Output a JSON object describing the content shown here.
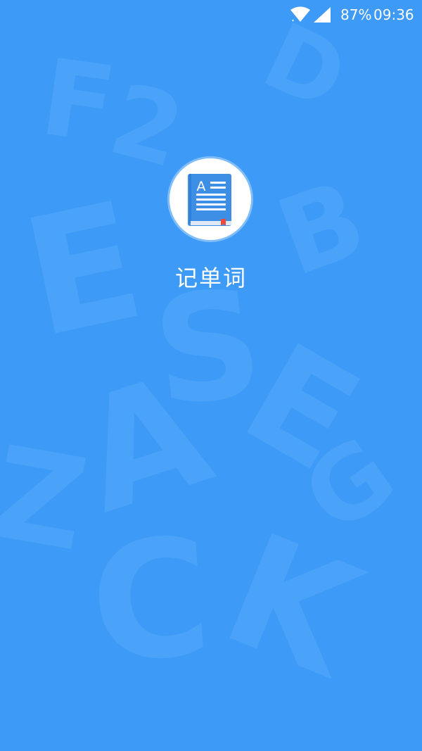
{
  "status_bar": {
    "battery": "87%",
    "time": "09:36"
  },
  "splash": {
    "app_name": "记单词",
    "logo_letter": "A",
    "logo_icon": "book-icon"
  },
  "background": {
    "letters": [
      "D",
      "E",
      "F",
      "S",
      "A",
      "E",
      "B",
      "C",
      "K",
      "2",
      "Z",
      "G"
    ]
  },
  "colors": {
    "background": "#3d9af6",
    "watermark_letters": "#4aa3f8",
    "logo_book": "#3d8fe6",
    "bookmark": "#ef4b3c"
  }
}
